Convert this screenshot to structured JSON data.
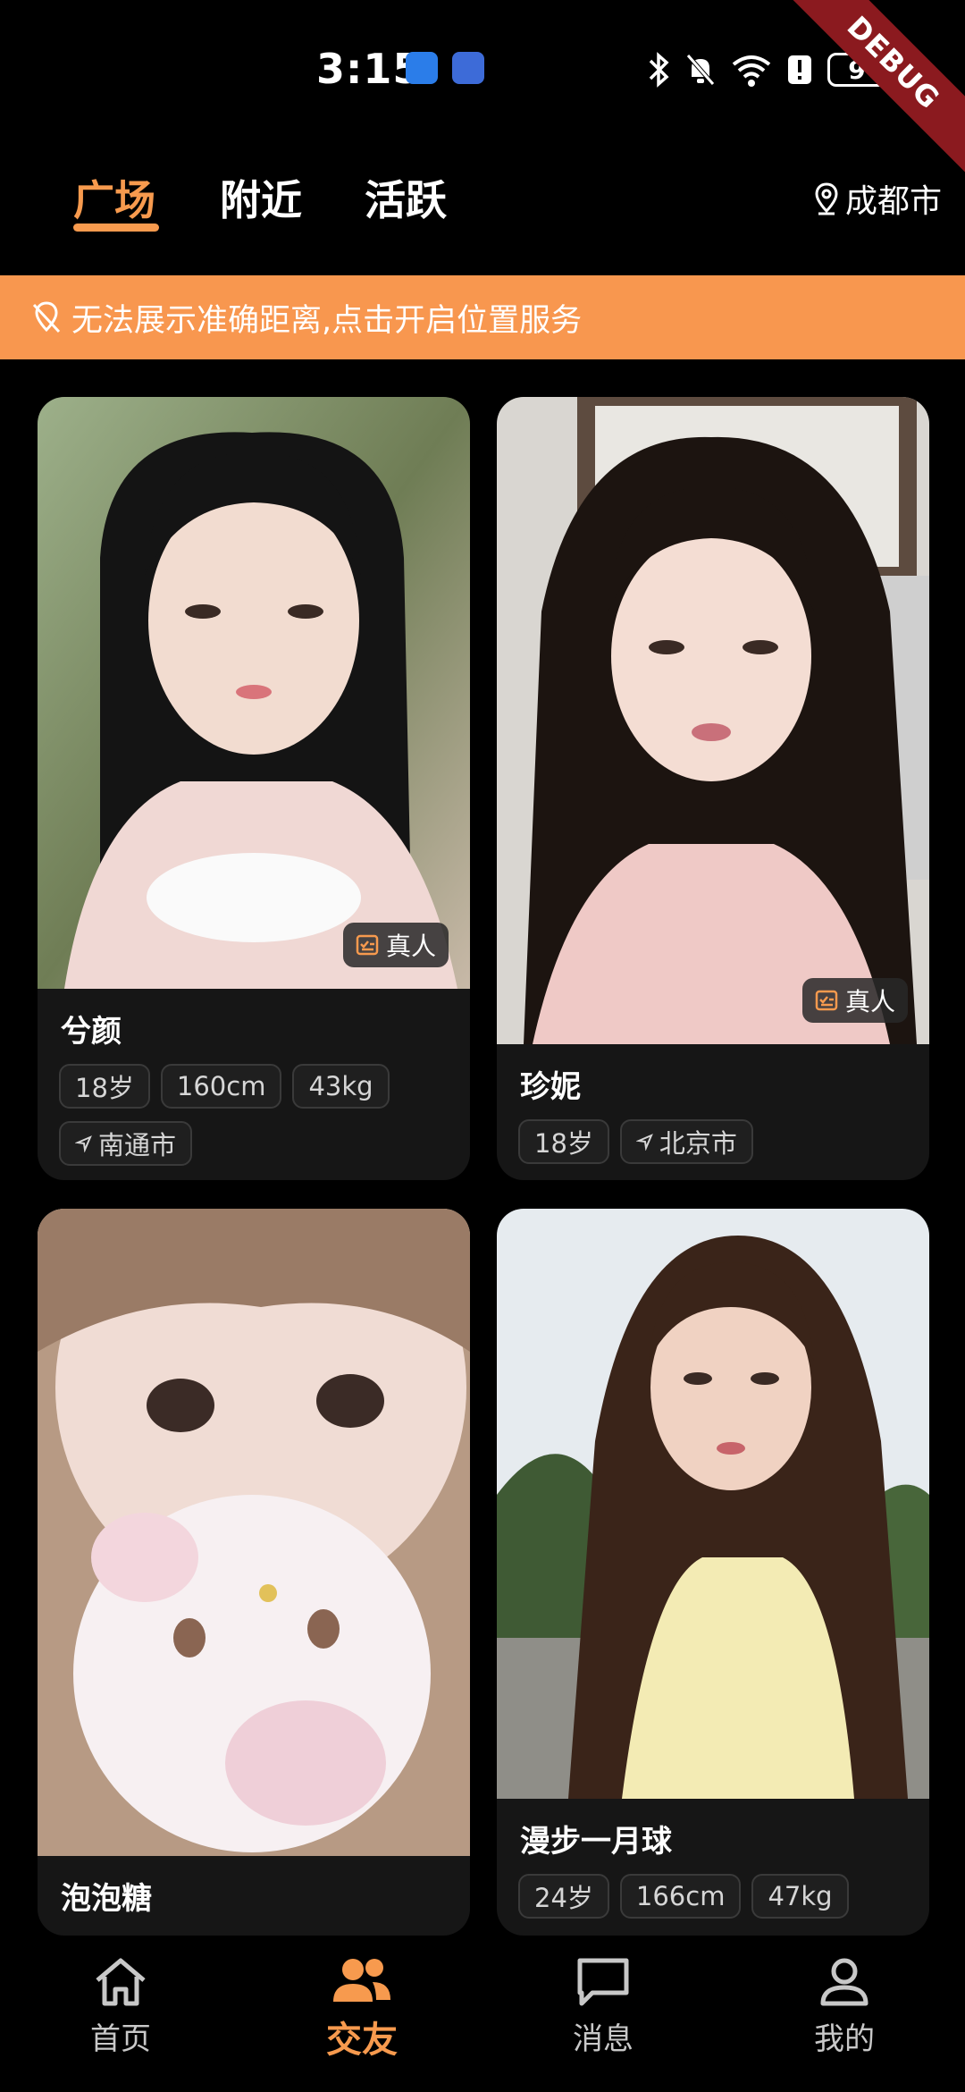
{
  "status_bar": {
    "time": "3:15",
    "battery_level": "9",
    "debug_label": "DEBUG"
  },
  "tabs": [
    {
      "label": "广场",
      "active": true
    },
    {
      "label": "附近",
      "active": false
    },
    {
      "label": "活跃",
      "active": false
    }
  ],
  "location": {
    "city": "成都市",
    "icon": "location-pin-icon"
  },
  "banner": {
    "text": "无法展示准确距离,点击开启位置服务",
    "icon": "location-off-icon"
  },
  "cards": [
    {
      "name": "兮颜",
      "badge": "真人",
      "tags": [
        "18岁",
        "160cm",
        "43kg"
      ],
      "city": "南通市"
    },
    {
      "name": "珍妮",
      "badge": "真人",
      "tags": [
        "18岁"
      ],
      "city": "北京市"
    },
    {
      "name": "泡泡糖",
      "tags": []
    },
    {
      "name": "漫步一月球",
      "tags": [
        "24岁",
        "166cm",
        "47kg"
      ]
    }
  ],
  "bottom_nav": [
    {
      "label": "首页",
      "icon": "home-icon",
      "active": false
    },
    {
      "label": "交友",
      "icon": "friends-icon",
      "active": true
    },
    {
      "label": "消息",
      "icon": "message-icon",
      "active": false
    },
    {
      "label": "我的",
      "icon": "profile-icon",
      "active": false
    }
  ],
  "colors": {
    "accent": "#f79a4e",
    "banner": "#f8974f",
    "background": "#000000",
    "card": "#161616"
  }
}
